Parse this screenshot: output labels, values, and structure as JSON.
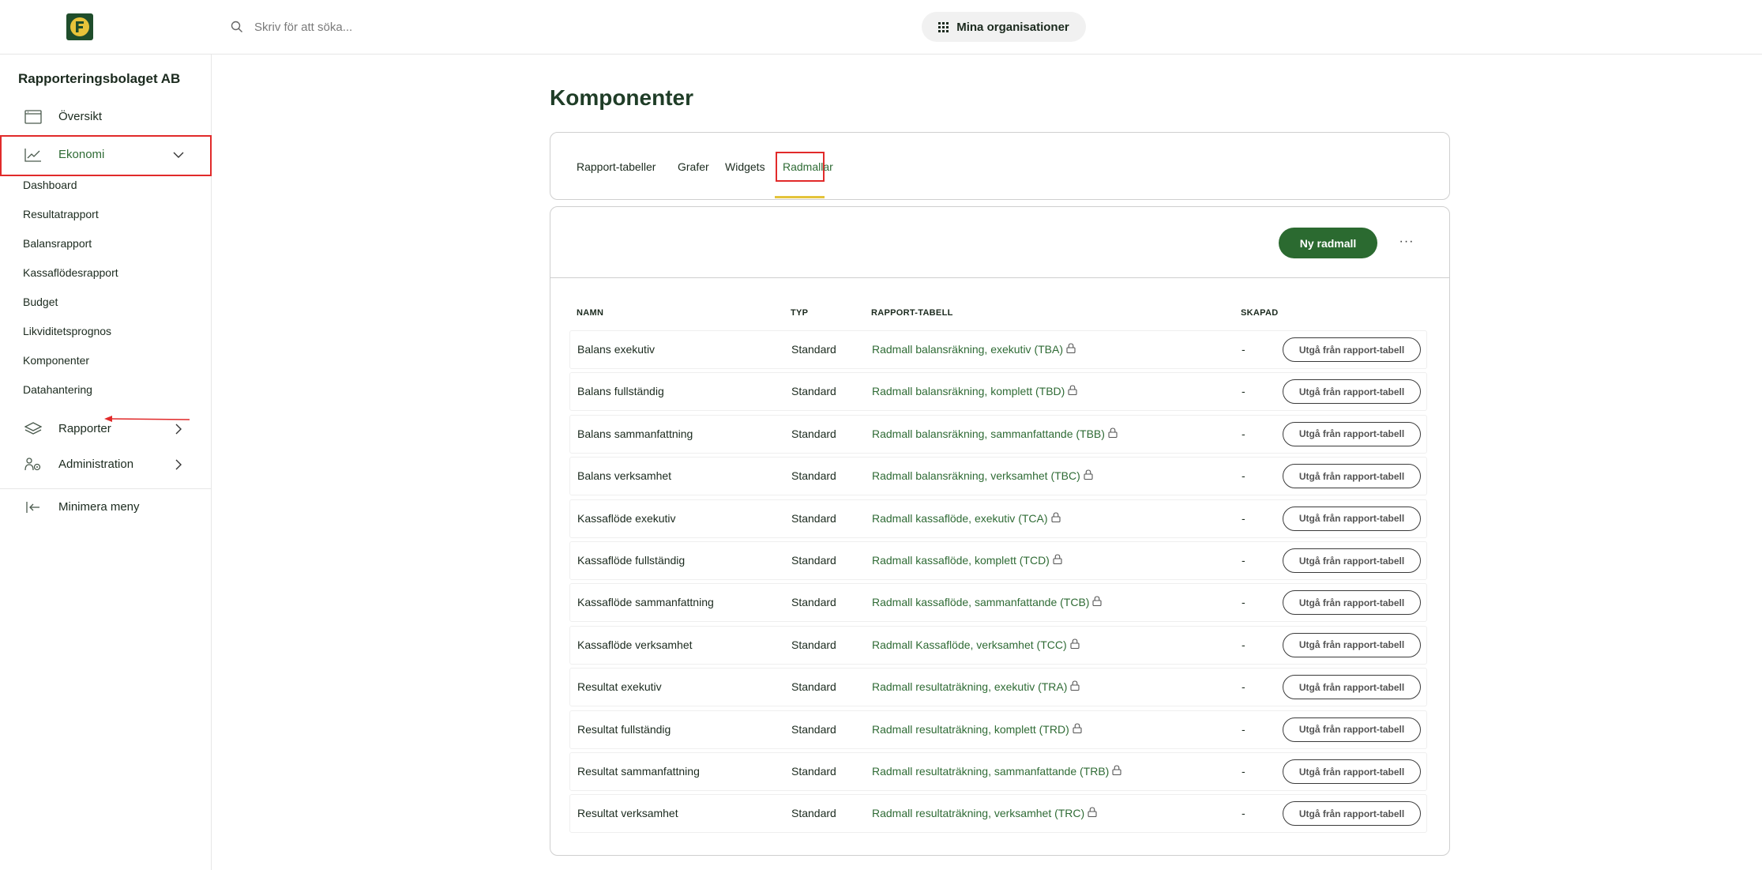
{
  "header": {
    "search_placeholder": "Skriv för att söka...",
    "org_button_label": "Mina organisationer"
  },
  "sidebar": {
    "company": "Rapporteringsbolaget AB",
    "main_items": [
      {
        "label": "Översikt",
        "icon": "window-icon"
      },
      {
        "label": "Ekonomi",
        "icon": "line-chart-icon",
        "expanded": true
      },
      {
        "label": "Rapporter",
        "icon": "layers-icon"
      },
      {
        "label": "Administration",
        "icon": "users-gear-icon"
      }
    ],
    "sub_items": [
      "Dashboard",
      "Resultatrapport",
      "Balansrapport",
      "Kassaflödesrapport",
      "Budget",
      "Likviditetsprognos",
      "Komponenter",
      "Datahantering"
    ],
    "minimize_label": "Minimera meny"
  },
  "main": {
    "title": "Komponenter",
    "tabs": [
      "Rapport-tabeller",
      "Grafer",
      "Widgets",
      "Radmallar"
    ],
    "active_tab": "Radmallar",
    "new_button": "Ny radmall",
    "more_button": "···",
    "columns": [
      "NAMN",
      "TYP",
      "RAPPORT-TABELL",
      "SKAPAD"
    ],
    "row_action": "Utgå från rapport-tabell",
    "rows": [
      {
        "name": "Balans exekutiv",
        "type": "Standard",
        "table": "Radmall balansräkning, exekutiv (TBA)",
        "created": "-"
      },
      {
        "name": "Balans fullständig",
        "type": "Standard",
        "table": "Radmall balansräkning, komplett (TBD)",
        "created": "-"
      },
      {
        "name": "Balans sammanfattning",
        "type": "Standard",
        "table": "Radmall balansräkning, sammanfattande (TBB)",
        "created": "-"
      },
      {
        "name": "Balans verksamhet",
        "type": "Standard",
        "table": "Radmall balansräkning, verksamhet (TBC)",
        "created": "-"
      },
      {
        "name": "Kassaflöde exekutiv",
        "type": "Standard",
        "table": "Radmall kassaflöde, exekutiv (TCA)",
        "created": "-"
      },
      {
        "name": "Kassaflöde fullständig",
        "type": "Standard",
        "table": "Radmall kassaflöde, komplett (TCD)",
        "created": "-"
      },
      {
        "name": "Kassaflöde sammanfattning",
        "type": "Standard",
        "table": "Radmall kassaflöde, sammanfattande (TCB)",
        "created": "-"
      },
      {
        "name": "Kassaflöde verksamhet",
        "type": "Standard",
        "table": "Radmall Kassaflöde, verksamhet (TCC)",
        "created": "-"
      },
      {
        "name": "Resultat exekutiv",
        "type": "Standard",
        "table": "Radmall resultaträkning, exekutiv (TRA)",
        "created": "-"
      },
      {
        "name": "Resultat fullständig",
        "type": "Standard",
        "table": "Radmall resultaträkning, komplett (TRD)",
        "created": "-"
      },
      {
        "name": "Resultat sammanfattning",
        "type": "Standard",
        "table": "Radmall resultaträkning, sammanfattande (TRB)",
        "created": "-"
      },
      {
        "name": "Resultat verksamhet",
        "type": "Standard",
        "table": "Radmall resultaträkning, verksamhet (TRC)",
        "created": "-"
      }
    ]
  },
  "colors": {
    "brand_green": "#2b6a30",
    "link_green": "#2f6b35",
    "annotation_red": "#e12a2a",
    "tab_underline": "#e4c33b"
  }
}
